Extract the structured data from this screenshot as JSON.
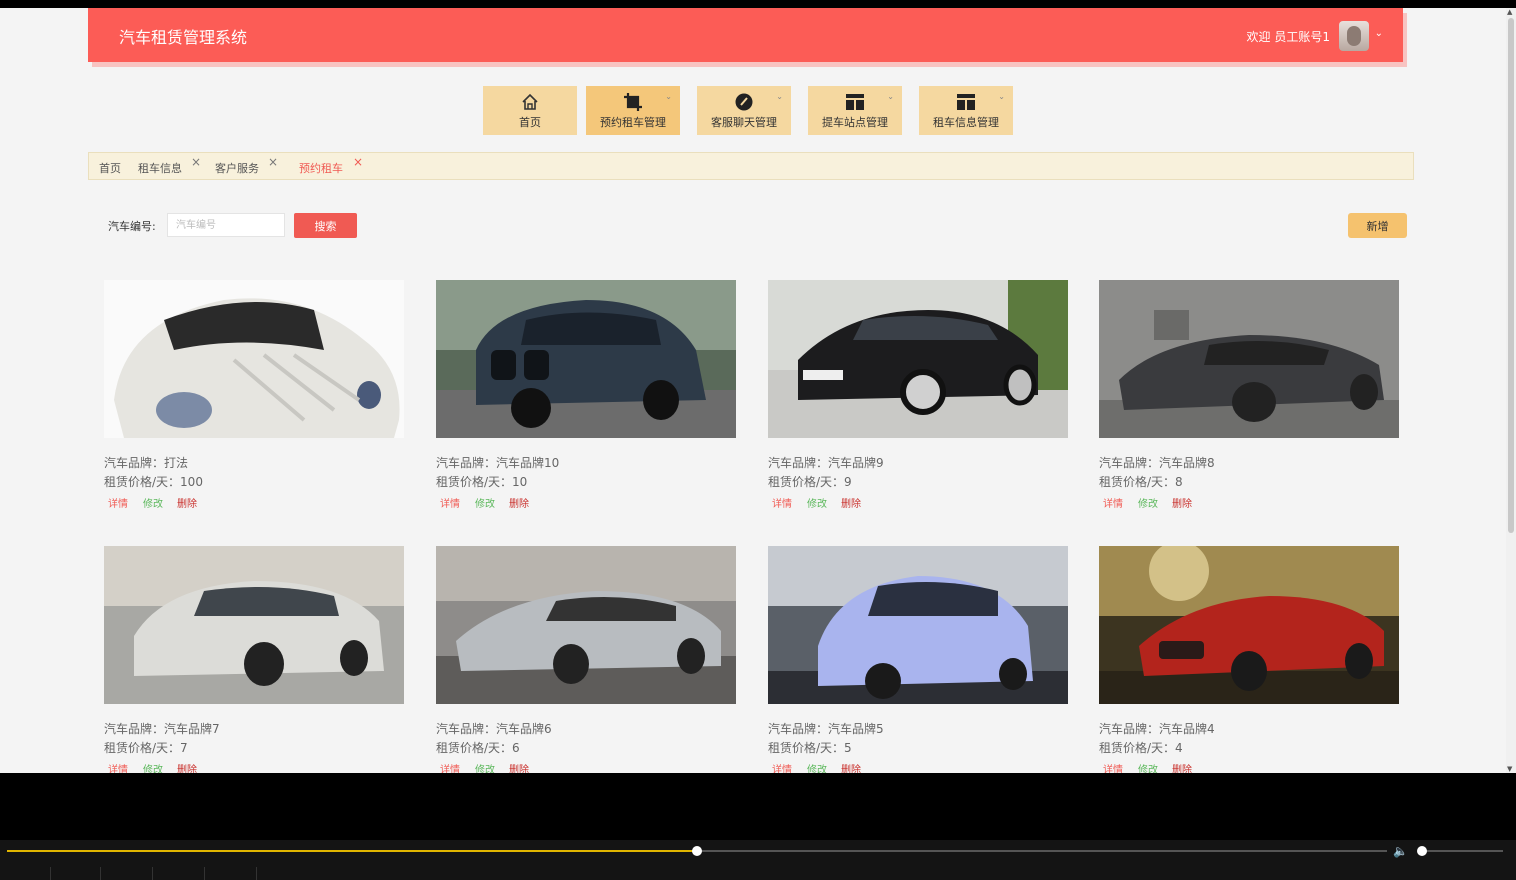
{
  "app": {
    "title": "汽车租赁管理系统",
    "welcome": "欢迎 员工账号1"
  },
  "menu": [
    {
      "label": "首页",
      "icon": "home-icon"
    },
    {
      "label": "预约租车管理",
      "icon": "crop-icon"
    },
    {
      "label": "客服聊天管理",
      "icon": "chat-icon"
    },
    {
      "label": "提车站点管理",
      "icon": "layout-icon"
    },
    {
      "label": "租车信息管理",
      "icon": "layout-icon"
    }
  ],
  "tabs": [
    {
      "label": "首页",
      "closable": false
    },
    {
      "label": "租车信息",
      "closable": true
    },
    {
      "label": "客户服务",
      "closable": true
    },
    {
      "label": "预约租车",
      "closable": true,
      "active": true
    }
  ],
  "tab_close": "×",
  "search": {
    "label": "汽车编号:",
    "placeholder": "汽车编号",
    "value": "",
    "button": "搜索"
  },
  "add_button": "新增",
  "card_labels": {
    "brand_prefix": "汽车品牌：",
    "price_prefix": "租赁价格/天：",
    "detail": "详情",
    "edit": "修改",
    "delete": "删除"
  },
  "cars": [
    {
      "brand": "打法",
      "price": "100",
      "color": "#e9e9e6"
    },
    {
      "brand": "汽车品牌10",
      "price": "10",
      "color": "#2d3a48"
    },
    {
      "brand": "汽车品牌9",
      "price": "9",
      "color": "#1c1c1e"
    },
    {
      "brand": "汽车品牌8",
      "price": "8",
      "color": "#3a3b3e"
    },
    {
      "brand": "汽车品牌7",
      "price": "7",
      "color": "#dcdcd8"
    },
    {
      "brand": "汽车品牌6",
      "price": "6",
      "color": "#b8bcc0"
    },
    {
      "brand": "汽车品牌5",
      "price": "5",
      "color": "#a9b4ee"
    },
    {
      "brand": "汽车品牌4",
      "price": "4",
      "color": "#b3241c"
    }
  ],
  "player": {
    "progress": 0.5,
    "volume": 0.05
  }
}
